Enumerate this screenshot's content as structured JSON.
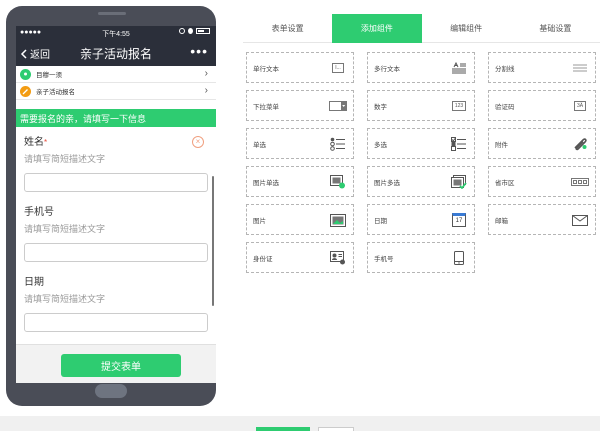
{
  "phone": {
    "status": {
      "signal": "●●●●●",
      "time": "下午4:55"
    },
    "nav": {
      "back_label": "返回",
      "title": "亲子活动报名",
      "more": "•••"
    },
    "info_rows": [
      {
        "icon": "location-pin-icon",
        "text": "目穆一须",
        "color": "#2ecc71"
      },
      {
        "icon": "pencil-icon",
        "text": "亲子活动报名",
        "color": "#f39c12"
      }
    ],
    "banner": "需要报名的亲，请填写一下信息",
    "fields": [
      {
        "label": "姓名",
        "required": "*",
        "hint": "请填写简短描述文字"
      },
      {
        "label": "手机号",
        "hint": "请填写简短描述文字"
      },
      {
        "label": "日期",
        "hint": "请填写简短描述文字"
      }
    ],
    "submit": "提交表单"
  },
  "tabs": [
    {
      "label": "表单设置",
      "active": false
    },
    {
      "label": "添加组件",
      "active": true
    },
    {
      "label": "编辑组件",
      "active": false
    },
    {
      "label": "基础设置",
      "active": false
    }
  ],
  "components": [
    {
      "label": "单行文本",
      "icon": "text-input-icon"
    },
    {
      "label": "多行文本",
      "icon": "textarea-icon"
    },
    {
      "label": "分割线",
      "icon": "divider-icon"
    },
    {
      "label": "下拉菜单",
      "icon": "dropdown-icon"
    },
    {
      "label": "数字",
      "icon": "number-icon"
    },
    {
      "label": "验证码",
      "icon": "captcha-icon"
    },
    {
      "label": "单选",
      "icon": "radio-list-icon"
    },
    {
      "label": "多选",
      "icon": "checkbox-list-icon"
    },
    {
      "label": "附件",
      "icon": "paperclip-icon"
    },
    {
      "label": "图片单选",
      "icon": "image-single-icon"
    },
    {
      "label": "图片多选",
      "icon": "image-multi-icon"
    },
    {
      "label": "省市区",
      "icon": "region-icon"
    },
    {
      "label": "图片",
      "icon": "image-icon"
    },
    {
      "label": "日期",
      "icon": "calendar-icon"
    },
    {
      "label": "邮箱",
      "icon": "mail-icon"
    },
    {
      "label": "身份证",
      "icon": "id-card-icon"
    },
    {
      "label": "手机号",
      "icon": "mobile-icon"
    }
  ],
  "icon_text": {
    "text_input": "I...",
    "number": "123",
    "captcha": "3Ä",
    "calendar_day": "17"
  },
  "colors": {
    "accent": "#2ecc71",
    "dark": "#2b2f3a",
    "phone_body": "#4a4d57"
  }
}
